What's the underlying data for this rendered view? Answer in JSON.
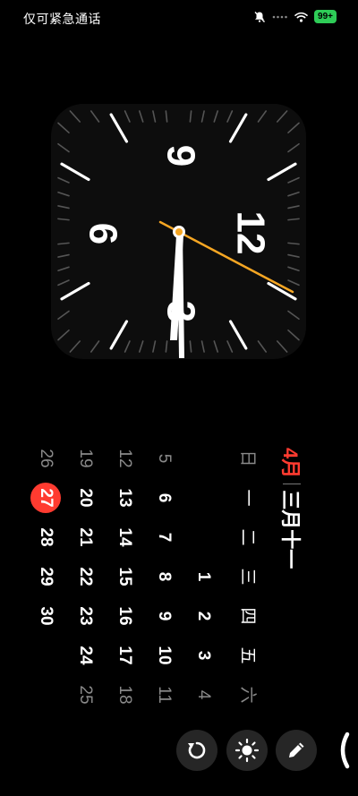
{
  "status_bar": {
    "carrier": "仅可紧急通话",
    "battery": "99+"
  },
  "clock": {
    "numerals": {
      "n12": "12",
      "n3": "3",
      "n6": "6",
      "n9": "9"
    },
    "colors": {
      "second_hand": "#f5a623",
      "face": "#0d0d0d"
    }
  },
  "calendar": {
    "month": "4月",
    "lunar": "三月十一",
    "weekdays": [
      "日",
      "一",
      "二",
      "三",
      "四",
      "五",
      "六"
    ],
    "weeks": [
      [
        "",
        "",
        "",
        "1",
        "2",
        "3",
        "4"
      ],
      [
        "5",
        "6",
        "7",
        "8",
        "9",
        "10",
        "11"
      ],
      [
        "12",
        "13",
        "14",
        "15",
        "16",
        "17",
        "18"
      ],
      [
        "19",
        "20",
        "21",
        "22",
        "23",
        "24",
        "25"
      ],
      [
        "26",
        "27",
        "28",
        "29",
        "30",
        "",
        ""
      ]
    ],
    "today": "27",
    "colors": {
      "accent": "#ff3b30"
    }
  },
  "buttons": {
    "rotate": "rotate-icon",
    "brightness": "brightness-icon",
    "edit": "pencil-icon"
  }
}
